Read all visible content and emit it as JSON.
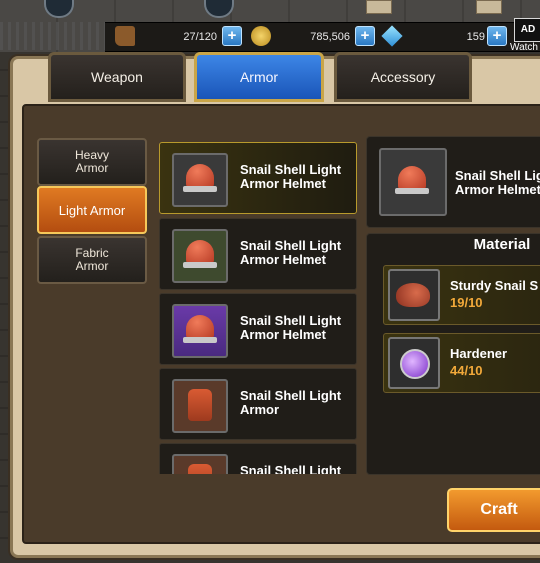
{
  "resources": {
    "stamina": {
      "value": "27/120",
      "icon": "boot-icon"
    },
    "gold": {
      "value": "785,506",
      "icon": "coin-icon"
    },
    "gems": {
      "value": "159",
      "icon": "gem-icon"
    },
    "ad": {
      "badge": "AD",
      "label": "Watch"
    }
  },
  "tabs": [
    {
      "label": "Weapon",
      "active": false
    },
    {
      "label": "Armor",
      "active": true
    },
    {
      "label": "Accessory",
      "active": false
    }
  ],
  "categories": [
    {
      "label_line1": "Heavy",
      "label_line2": "Armor",
      "active": false
    },
    {
      "label_line1": "Light Armor",
      "label_line2": "",
      "active": true
    },
    {
      "label_line1": "Fabric",
      "label_line2": "Armor",
      "active": false
    }
  ],
  "items": [
    {
      "line1": "Snail Shell Light",
      "line2": "Armor Helmet",
      "frame": "gray",
      "selected": true
    },
    {
      "line1": "Snail Shell Light",
      "line2": "Armor Helmet",
      "frame": "green",
      "selected": false
    },
    {
      "line1": "Snail Shell Light",
      "line2": "Armor Helmet",
      "frame": "purple",
      "selected": false
    },
    {
      "line1": "Snail Shell Light",
      "line2": "Armor",
      "frame": "brown",
      "selected": false
    },
    {
      "line1": "Snail Shell Light",
      "line2": "",
      "frame": "brown",
      "selected": false
    }
  ],
  "detail": {
    "line1": "Snail Shell Lig",
    "line2": "Armor Helmet"
  },
  "material": {
    "title": "Material",
    "entries": [
      {
        "name": "Sturdy Snail S",
        "count": "19/10",
        "icon": "snail-shell-icon"
      },
      {
        "name": "Hardener",
        "count": "44/10",
        "icon": "potion-flask-icon"
      }
    ]
  },
  "craft_label": "Craft",
  "colors": {
    "accent_tab": "#2a6fd6",
    "active_category": "#d0661a",
    "count": "#f2a93a",
    "craft": "#e07a22"
  }
}
